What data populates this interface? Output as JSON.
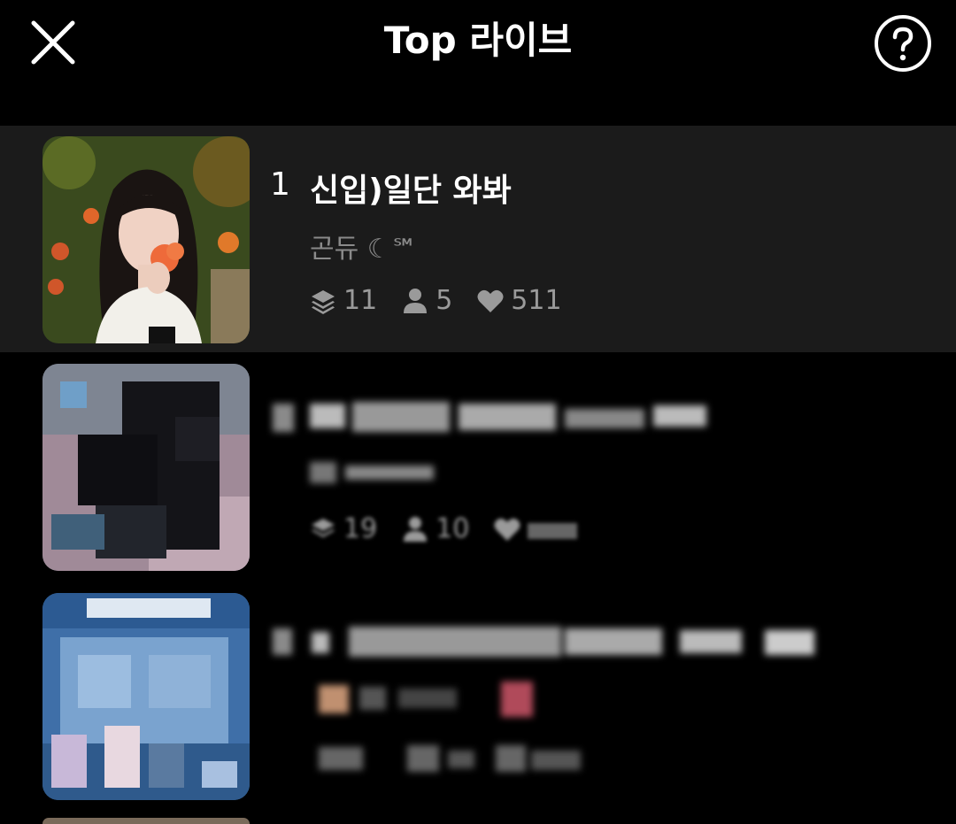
{
  "header": {
    "title": "Top 라이브",
    "close_icon": "close-icon",
    "help_icon": "help-circle-icon"
  },
  "items": [
    {
      "rank": "1",
      "name": "신입)일단 와봐",
      "host": "곤듀 ☾℠",
      "stats": {
        "layers": "11",
        "viewers": "5",
        "likes": "511"
      },
      "highlighted": true
    },
    {
      "rank": "2",
      "name": "",
      "host": "",
      "stats": {
        "layers": "19",
        "viewers": "10",
        "likes": ""
      },
      "censored": true
    },
    {
      "rank": "3",
      "name": "",
      "host": "",
      "stats": {
        "layers": "",
        "viewers": "",
        "likes": ""
      },
      "censored": true
    }
  ],
  "colors": {
    "background": "#000000",
    "highlight_row": "#1b1b1b",
    "secondary_text": "#8a8a8a"
  }
}
